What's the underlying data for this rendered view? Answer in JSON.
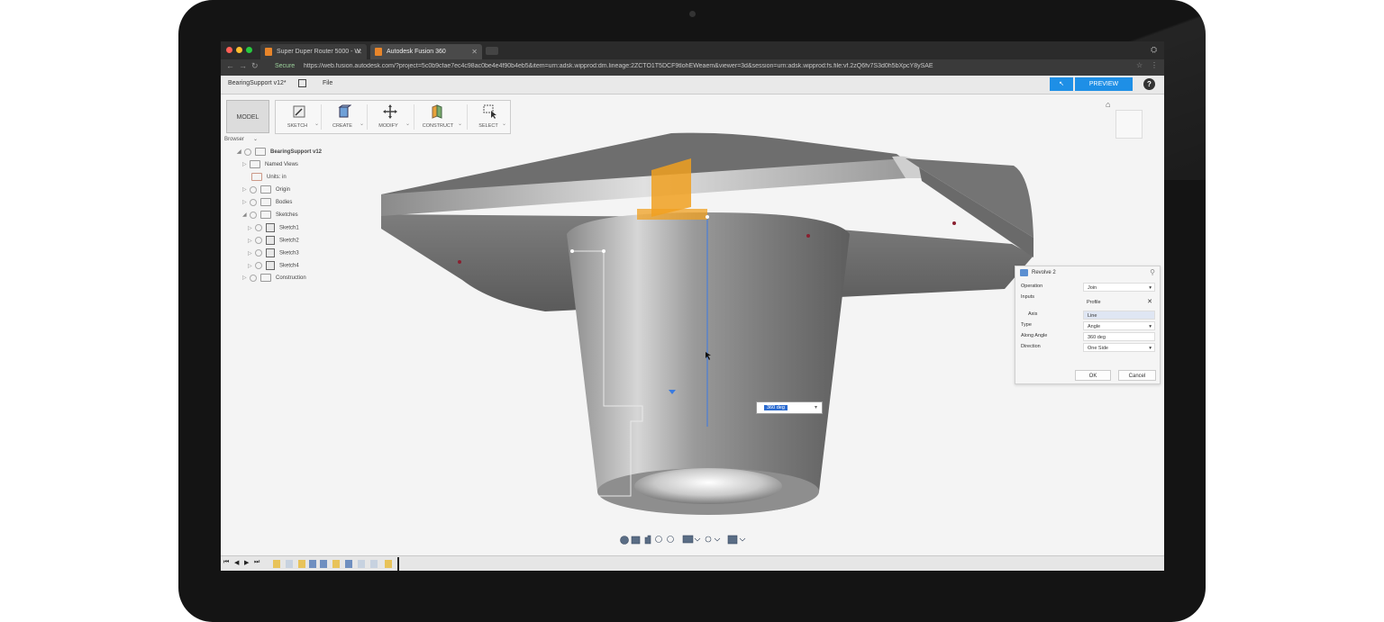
{
  "browser": {
    "tabs": [
      {
        "label": "Super Duper Router 5000 - W",
        "active": false
      },
      {
        "label": "Autodesk Fusion 360",
        "active": true
      }
    ],
    "secure_label": "Secure",
    "url": "https://web.fusion.autodesk.com/?project=5c0b9cfae7ec4c98ac0be4e4f90b4eb5&item=urn:adsk.wipprod:dm.lineage:2ZCTO1T5DCF9tlohEWeaem&viewer=3d&session=urn:adsk.wipprod:fs.file:vf.2zQ6fv7S3d0h5bXpcY8ySAE"
  },
  "app": {
    "doc_title": "BearingSupport v12*",
    "file_menu": "File",
    "preview_label": "PREVIEW",
    "help_label": "?",
    "workspace": "MODEL"
  },
  "toolbar": {
    "tools": [
      {
        "label": "SKETCH",
        "icon": "sketch-icon"
      },
      {
        "label": "CREATE",
        "icon": "create-icon"
      },
      {
        "label": "MODIFY",
        "icon": "move-icon"
      },
      {
        "label": "CONSTRUCT",
        "icon": "construct-icon"
      },
      {
        "label": "SELECT",
        "icon": "select-icon"
      }
    ]
  },
  "tree": {
    "browse_label": "Browser",
    "root": "BearingSupport v12",
    "items": [
      {
        "label": "Named Views"
      },
      {
        "label": "Units: in"
      },
      {
        "label": "Origin"
      },
      {
        "label": "Bodies"
      },
      {
        "label": "Sketches"
      },
      {
        "label": "Sketch1"
      },
      {
        "label": "Sketch2"
      },
      {
        "label": "Sketch3"
      },
      {
        "label": "Sketch4"
      },
      {
        "label": "Construction"
      }
    ]
  },
  "revolve": {
    "title": "Revolve 2",
    "rows": [
      {
        "label": "Operation",
        "value": "Join"
      },
      {
        "label": "Inputs",
        "value": ""
      },
      {
        "label": "",
        "value": "Profile"
      },
      {
        "label": "Axis",
        "value": "Line"
      },
      {
        "label": "Type",
        "value": "Angle"
      },
      {
        "label": "Along Angle",
        "value": "360 deg"
      },
      {
        "label": "Direction",
        "value": "One Side"
      }
    ],
    "ok_label": "OK",
    "cancel_label": "Cancel"
  },
  "canvas": {
    "angle_input": "360 deg"
  },
  "colors": {
    "accent": "#1e8fe6",
    "sketch_highlight": "#f0a020"
  }
}
